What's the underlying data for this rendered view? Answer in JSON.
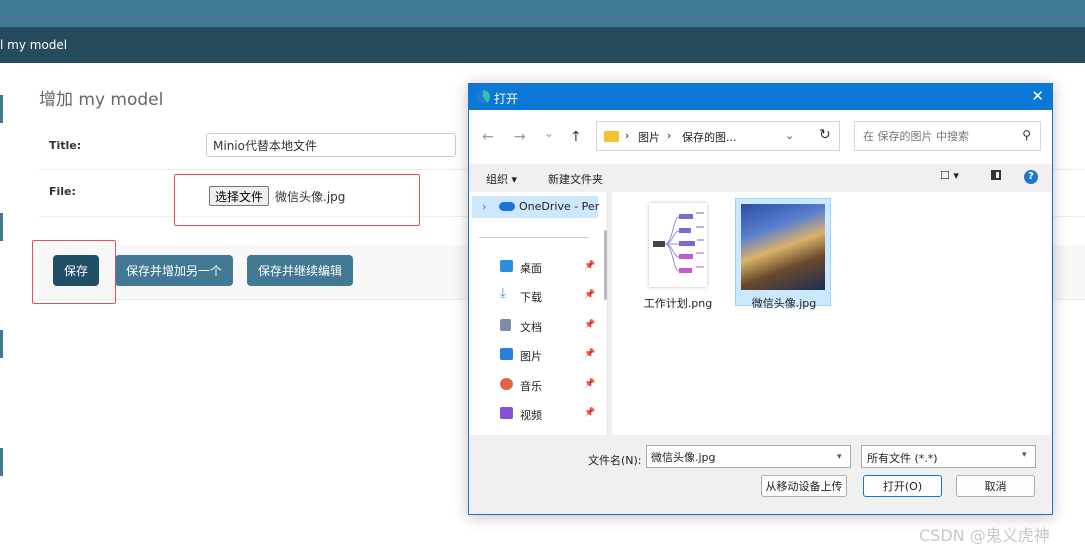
{
  "admin": {
    "breadcrumb": "l my model",
    "page_title_prefix": "增加",
    "page_title_model": "my model",
    "title_label": "Title:",
    "title_value": "Minio代替本地文件",
    "file_label": "File:",
    "choose_file_button": "选择文件",
    "chosen_file": "微信头像.jpg",
    "save_button": "保存",
    "save_add_another_button": "保存并增加另一个",
    "save_continue_button": "保存并继续编辑"
  },
  "dialog": {
    "title": "打开",
    "close_glyph": "✕",
    "nav": {
      "back": "←",
      "forward": "→",
      "recent": "⌄",
      "up": "↑",
      "refresh": "↻"
    },
    "address": {
      "seg1": "图片",
      "seg2": "保存的图...",
      "sep": "›"
    },
    "search_placeholder": "在 保存的图片 中搜索",
    "toolbar": {
      "organize": "组织 ▾",
      "new_folder": "新建文件夹"
    },
    "nav_pane": {
      "onedrive": "OneDrive - Per",
      "items": [
        {
          "label": "桌面",
          "color": "#2b8fe0"
        },
        {
          "label": "下载",
          "color": "#2b8fe0"
        },
        {
          "label": "文档",
          "color": "#7a8ea6"
        },
        {
          "label": "图片",
          "color": "#2b7fd8"
        },
        {
          "label": "音乐",
          "color": "#e2634a"
        },
        {
          "label": "视频",
          "color": "#8a4fd6"
        }
      ]
    },
    "files": [
      {
        "name": "工作计划.png",
        "selected": false
      },
      {
        "name": "微信头像.jpg",
        "selected": true
      }
    ],
    "filename_label": "文件名(N):",
    "filename_value": "微信头像.jpg",
    "filetype_value": "所有文件 (*.*)",
    "upload_button": "从移动设备上传",
    "open_button": "打开(O)",
    "cancel_button": "取消"
  },
  "watermark": "CSDN @鬼义虎神"
}
